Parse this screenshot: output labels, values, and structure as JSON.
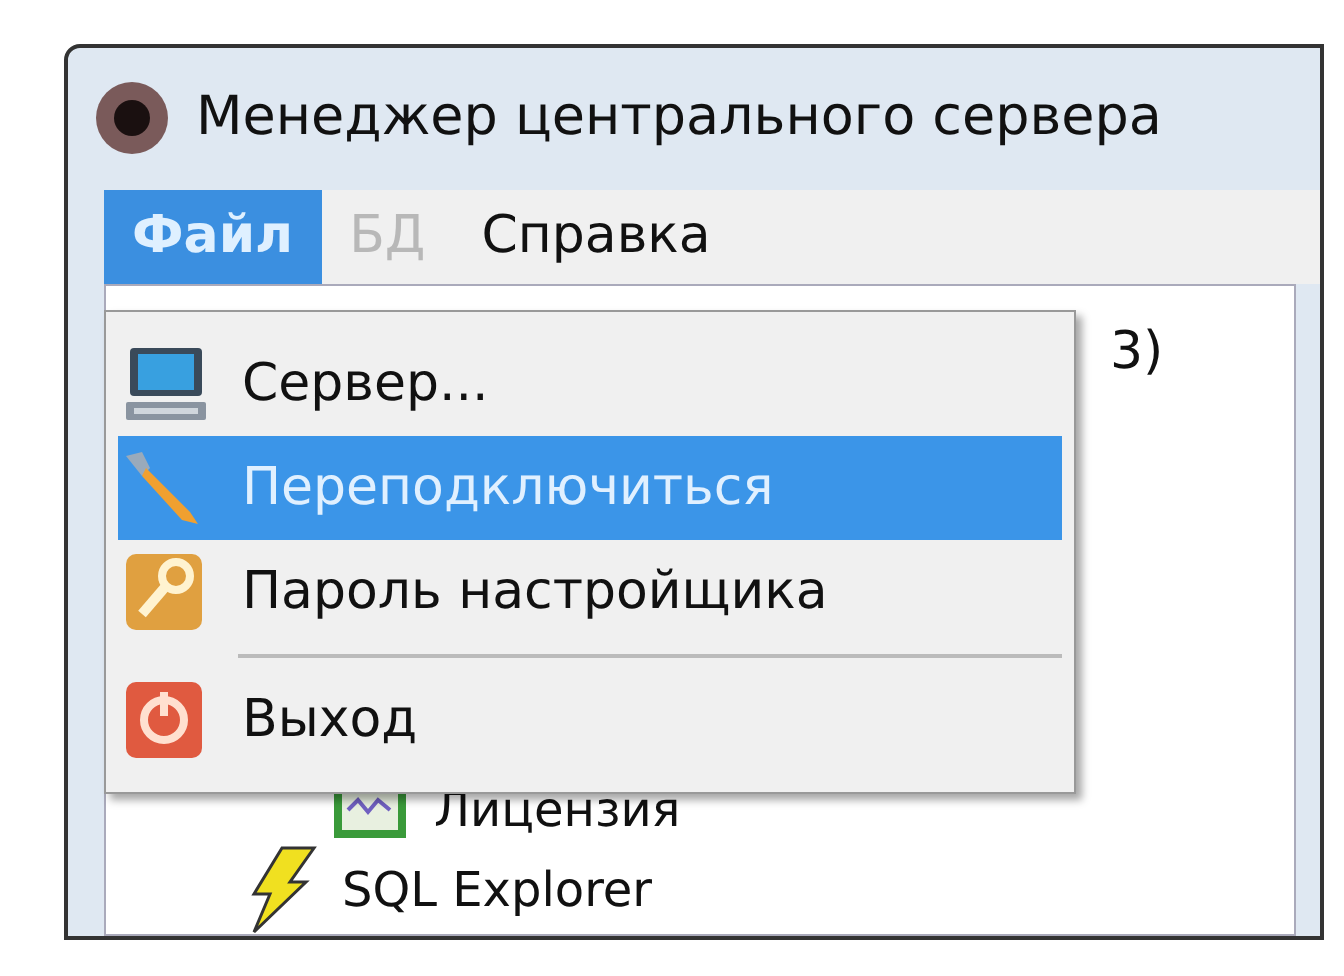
{
  "window": {
    "title": "Менеджер центрального сервера"
  },
  "menubar": [
    {
      "label": "Файл",
      "selected": true,
      "disabled": false
    },
    {
      "label": "БД",
      "selected": false,
      "disabled": true
    },
    {
      "label": "Справка",
      "selected": false,
      "disabled": false
    }
  ],
  "menu": [
    {
      "kind": "item",
      "label": "Сервер...",
      "selected": false
    },
    {
      "kind": "item",
      "label": "Переподключиться",
      "selected": true
    },
    {
      "kind": "item",
      "label": "Пароль настройщика",
      "selected": false
    },
    {
      "kind": "separator"
    },
    {
      "kind": "item",
      "label": "Выход",
      "selected": false
    }
  ],
  "tree": {
    "partial_text": "3)",
    "items": [
      {
        "label": "Лицензия"
      },
      {
        "label": "SQL Explorer"
      }
    ]
  }
}
